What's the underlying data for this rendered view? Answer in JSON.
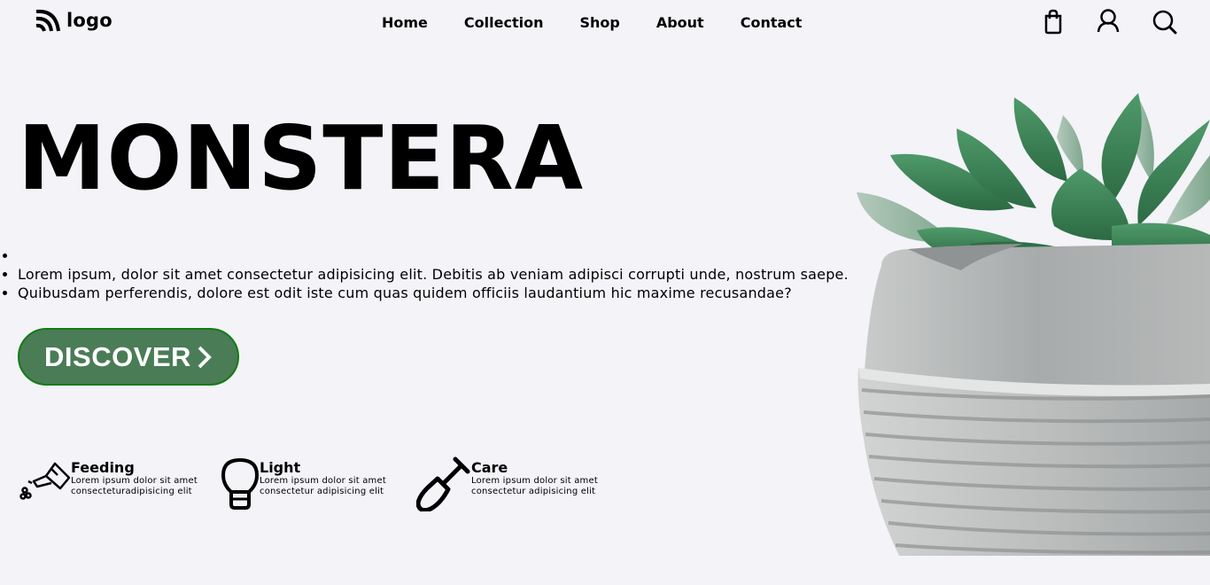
{
  "header": {
    "logo_text": "logo",
    "nav": [
      "Home",
      "Collection",
      "Shop",
      "About",
      "Contact"
    ]
  },
  "hero": {
    "title": "MONSTERA",
    "desc_lines": [
      "Lorem ipsum, dolor sit amet consectetur adipisicing elit. Debitis ab veniam adipisci corrupti unde, nostrum saepe.",
      "Quibusdam perferendis, dolore est odit iste cum quas quidem officiis laudantium hic maxime recusandae?"
    ],
    "cta_label": "DISCOVER",
    "accent_color": "#4a7c56"
  },
  "features": [
    {
      "title": "Feeding",
      "desc_line1": "Lorem ipsum dolor sit amet",
      "desc_line2": "consecteturadipisicing elit",
      "icon": "watering-can-icon"
    },
    {
      "title": "Light",
      "desc_line1": "Lorem ipsum dolor sit amet",
      "desc_line2": "consectetur adipisicing elit",
      "icon": "lightbulb-icon"
    },
    {
      "title": "Care",
      "desc_line1": "Lorem ipsum dolor sit amet",
      "desc_line2": "consectetur adipisicing elit",
      "icon": "shovel-icon"
    }
  ]
}
